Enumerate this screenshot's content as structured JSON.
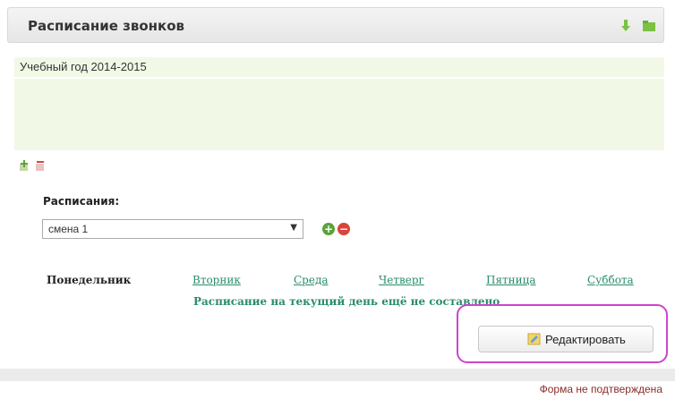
{
  "header": {
    "title": "Расписание звонков",
    "icons": [
      "download-icon",
      "folder-icon"
    ],
    "accent": "#7cc142"
  },
  "year": {
    "label": "Учебный год 2014-2015"
  },
  "toolbar_icons": [
    "add-doc-icon",
    "remove-doc-icon"
  ],
  "schedules": {
    "label": "Расписания:",
    "selected": "смена 1",
    "add_icon": "+",
    "remove_icon": "−"
  },
  "days": {
    "monday": "Понедельник",
    "tuesday": "Вторник",
    "wednesday": "Среда",
    "thursday": "Четверг",
    "friday": "Пятница",
    "saturday": "Суббота"
  },
  "message": "Расписание на текущий день ещё не составлено",
  "edit_button": {
    "label": "Редактировать",
    "icon": "edit-note-icon"
  },
  "status": "Форма не подтверждена",
  "colors": {
    "green_panel": "#f1f9e6",
    "link": "#2a8c6e",
    "highlight": "#cc44cc",
    "status_text": "#8a2b2b"
  }
}
